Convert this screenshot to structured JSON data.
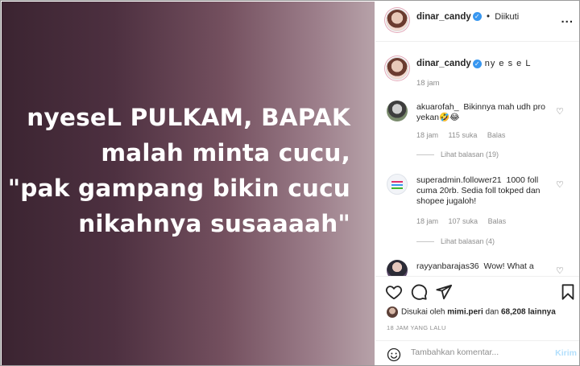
{
  "post_image": {
    "lines": [
      "nyeseL PULKAM, BAPAK",
      "malah minta cucu,",
      "\"pak gampang bikin cucu",
      "nikahnya susaaaah\""
    ]
  },
  "header": {
    "username": "dinar_candy",
    "separator": "•",
    "follow_state": "Diikuti",
    "more": "..."
  },
  "caption": {
    "username": "dinar_candy",
    "text": "ny e s e L",
    "time": "18 jam"
  },
  "comments": [
    {
      "username": "akuarofah_",
      "text": "Bikinnya mah udh pro yekan🤣😂",
      "time": "18 jam",
      "likes": "115 suka",
      "reply_label": "Balas",
      "replies": "Lihat balasan (19)"
    },
    {
      "username": "superadmin.follower21",
      "text": "1000 foll cuma 20rb. Sedia foll tokped dan shopee jugaloh!",
      "time": "18 jam",
      "likes": "107 suka",
      "reply_label": "Balas",
      "replies": "Lihat balasan (4)"
    },
    {
      "username": "rayyanbarajas36",
      "text": "Wow! What a"
    }
  ],
  "likes_line": {
    "prefix": "Disukai oleh",
    "user": "mimi.peri",
    "middle": "dan",
    "count": "68,208 lainnya"
  },
  "time_ago": "18 JAM YANG LALU",
  "add_comment": {
    "placeholder": "Tambahkan komentar...",
    "post_label": "Kirim"
  },
  "colors": {
    "verified": "#3897f0",
    "post_disabled": "#b2dffc",
    "muted": "#8e8e8e"
  }
}
